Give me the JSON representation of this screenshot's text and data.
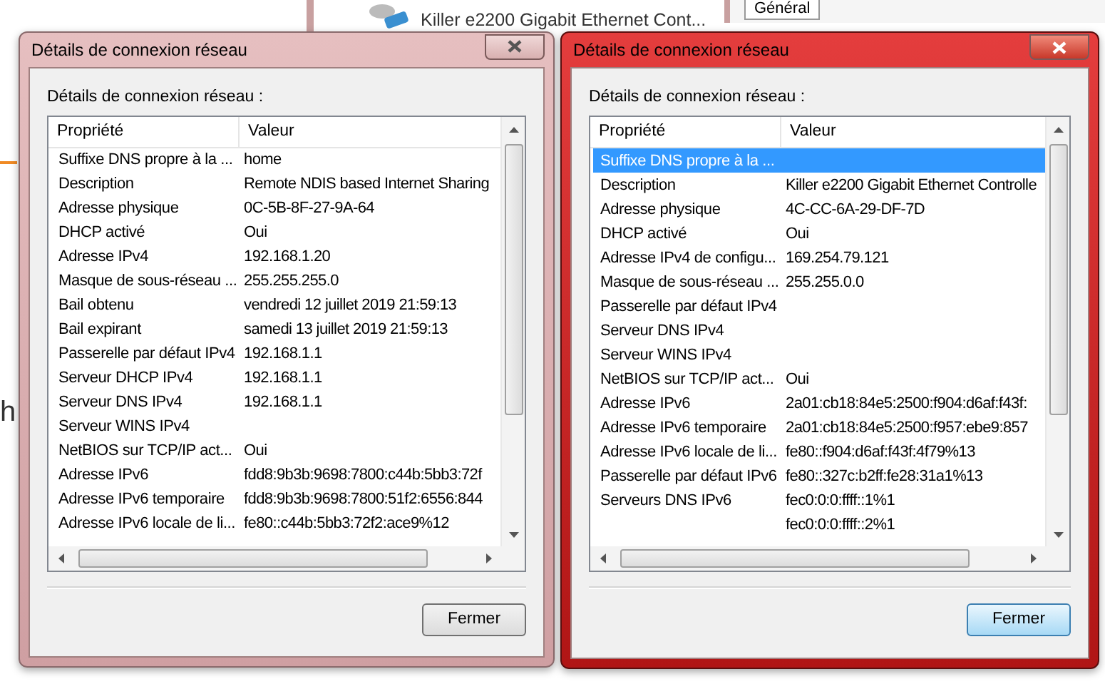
{
  "background": {
    "adapter_name": "Killer e2200 Gigabit Ethernet Cont...",
    "tab_label": "Général",
    "fragment_text": "h"
  },
  "dialogs": [
    {
      "title": "Détails de connexion réseau",
      "active": false,
      "label": "Détails de connexion réseau :",
      "columns": [
        "Propriété",
        "Valeur"
      ],
      "button": "Fermer",
      "rows": [
        {
          "property": "Suffixe DNS propre à la ...",
          "value": "home",
          "selected": false
        },
        {
          "property": "Description",
          "value": "Remote NDIS based Internet Sharing",
          "selected": false
        },
        {
          "property": "Adresse physique",
          "value": "0C-5B-8F-27-9A-64",
          "selected": false
        },
        {
          "property": "DHCP activé",
          "value": "Oui",
          "selected": false
        },
        {
          "property": "Adresse IPv4",
          "value": "192.168.1.20",
          "selected": false
        },
        {
          "property": "Masque de sous-réseau ...",
          "value": "255.255.255.0",
          "selected": false
        },
        {
          "property": "Bail obtenu",
          "value": "vendredi 12 juillet 2019 21:59:13",
          "selected": false
        },
        {
          "property": "Bail expirant",
          "value": "samedi 13 juillet 2019 21:59:13",
          "selected": false
        },
        {
          "property": "Passerelle par défaut IPv4",
          "value": "192.168.1.1",
          "selected": false
        },
        {
          "property": "Serveur DHCP IPv4",
          "value": "192.168.1.1",
          "selected": false
        },
        {
          "property": "Serveur DNS IPv4",
          "value": "192.168.1.1",
          "selected": false
        },
        {
          "property": "Serveur WINS IPv4",
          "value": "",
          "selected": false
        },
        {
          "property": "NetBIOS sur TCP/IP act...",
          "value": "Oui",
          "selected": false
        },
        {
          "property": "Adresse IPv6",
          "value": "fdd8:9b3b:9698:7800:c44b:5bb3:72f",
          "selected": false
        },
        {
          "property": "Adresse IPv6 temporaire",
          "value": "fdd8:9b3b:9698:7800:51f2:6556:844",
          "selected": false
        },
        {
          "property": "Adresse IPv6 locale de li...",
          "value": "fe80::c44b:5bb3:72f2:ace9%12",
          "selected": false
        }
      ]
    },
    {
      "title": "Détails de connexion réseau",
      "active": true,
      "label": "Détails de connexion réseau :",
      "columns": [
        "Propriété",
        "Valeur"
      ],
      "button": "Fermer",
      "rows": [
        {
          "property": "Suffixe DNS propre à la ...",
          "value": "",
          "selected": true
        },
        {
          "property": "Description",
          "value": "Killer e2200 Gigabit Ethernet Controlle",
          "selected": false
        },
        {
          "property": "Adresse physique",
          "value": "4C-CC-6A-29-DF-7D",
          "selected": false
        },
        {
          "property": "DHCP activé",
          "value": "Oui",
          "selected": false
        },
        {
          "property": "Adresse IPv4 de configu...",
          "value": "169.254.79.121",
          "selected": false
        },
        {
          "property": "Masque de sous-réseau ...",
          "value": "255.255.0.0",
          "selected": false
        },
        {
          "property": "Passerelle par défaut IPv4",
          "value": "",
          "selected": false
        },
        {
          "property": "Serveur DNS IPv4",
          "value": "",
          "selected": false
        },
        {
          "property": "Serveur WINS IPv4",
          "value": "",
          "selected": false
        },
        {
          "property": "NetBIOS sur TCP/IP act...",
          "value": "Oui",
          "selected": false
        },
        {
          "property": "Adresse IPv6",
          "value": "2a01:cb18:84e5:2500:f904:d6af:f43f:",
          "selected": false
        },
        {
          "property": "Adresse IPv6 temporaire",
          "value": "2a01:cb18:84e5:2500:f957:ebe9:857",
          "selected": false
        },
        {
          "property": "Adresse IPv6 locale de li...",
          "value": "fe80::f904:d6af:f43f:4f79%13",
          "selected": false
        },
        {
          "property": "Passerelle par défaut IPv6",
          "value": "fe80::327c:b2ff:fe28:31a1%13",
          "selected": false
        },
        {
          "property": "Serveurs DNS IPv6",
          "value": "fec0:0:0:ffff::1%1",
          "selected": false
        },
        {
          "property": "",
          "value": "fec0:0:0:ffff::2%1",
          "selected": false
        }
      ]
    }
  ]
}
